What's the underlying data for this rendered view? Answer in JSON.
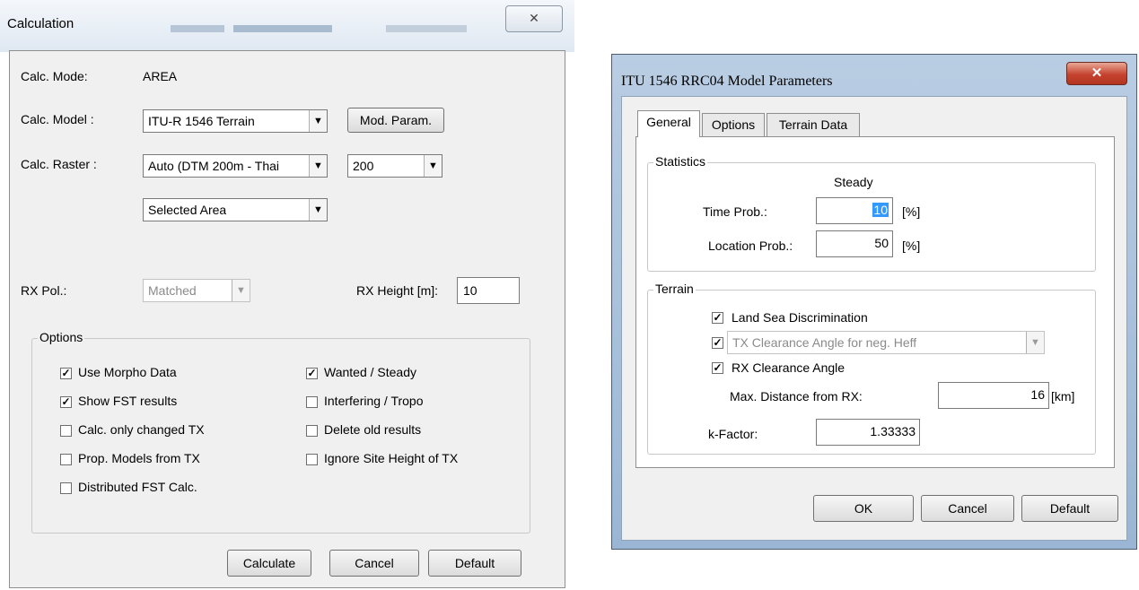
{
  "calc_dialog": {
    "title": "Calculation",
    "close_glyph": "✕",
    "calc_mode_label": "Calc. Mode:",
    "calc_mode_value": "AREA",
    "calc_model_label": "Calc. Model :",
    "calc_model_value": "ITU-R 1546 Terrain",
    "mod_param_button": "Mod. Param.",
    "calc_raster_label": "Calc. Raster :",
    "calc_raster_value": "Auto (DTM 200m - Thai",
    "raster_size_value": "200",
    "area_value": "Selected Area",
    "rx_pol_label": "RX Pol.:",
    "rx_pol_value": "Matched",
    "rx_height_label": "RX Height [m]:",
    "rx_height_value": "10",
    "options_caption": "Options",
    "options": [
      {
        "label": "Use Morpho Data",
        "checked": true
      },
      {
        "label": "Show FST results",
        "checked": true
      },
      {
        "label": "Calc. only changed TX",
        "checked": false
      },
      {
        "label": "Prop. Models from TX",
        "checked": false
      },
      {
        "label": "Distributed FST Calc.",
        "checked": false
      },
      {
        "label": "Wanted / Steady",
        "checked": true
      },
      {
        "label": "Interfering / Tropo",
        "checked": false
      },
      {
        "label": "Delete old results",
        "checked": false
      },
      {
        "label": "Ignore Site Height of TX",
        "checked": false
      }
    ],
    "calculate_button": "Calculate",
    "cancel_button": "Cancel",
    "default_button": "Default"
  },
  "param_dialog": {
    "title": "ITU 1546 RRC04 Model Parameters",
    "close_glyph": "✕",
    "tabs": [
      "General",
      "Options",
      "Terrain Data"
    ],
    "statistics_caption": "Statistics",
    "steady_header": "Steady",
    "time_prob_label": "Time Prob.:",
    "time_prob_value": "10",
    "location_prob_label": "Location Prob.:",
    "location_prob_value": "50",
    "percent_unit": "[%]",
    "terrain_caption": "Terrain",
    "land_sea_label": "Land Sea Discrimination",
    "land_sea_checked": true,
    "tx_clearance_label": "TX Clearance Angle for neg. Heff",
    "tx_clearance_checked": true,
    "rx_clearance_label": "RX Clearance Angle",
    "rx_clearance_checked": true,
    "max_distance_label": "Max. Distance from RX:",
    "max_distance_value": "16",
    "km_unit": "[km]",
    "k_factor_label": "k-Factor:",
    "k_factor_value": "1.33333",
    "ok_button": "OK",
    "cancel_button": "Cancel",
    "default_button": "Default"
  },
  "colors": {
    "dialog_face": "#f0f0f0",
    "close_red": "#c5432e",
    "selection_blue": "#3399ff"
  }
}
